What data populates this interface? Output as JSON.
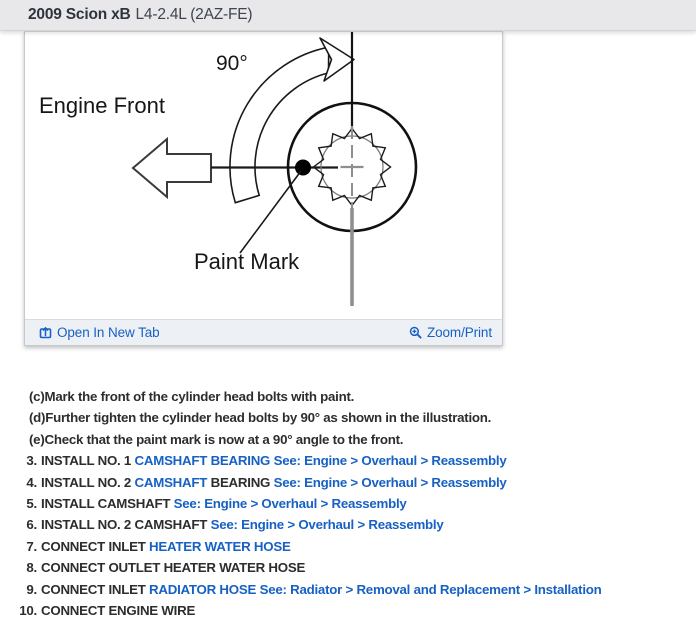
{
  "header": {
    "title_bold": "2009 Scion xB",
    "title_rest": "L4-2.4L (2AZ-FE)"
  },
  "figure": {
    "labels": {
      "angle": "90°",
      "engine_front": "Engine Front",
      "paint_mark": "Paint Mark"
    },
    "toolbar": {
      "open_in_new_tab": "Open In New Tab",
      "zoom_print": "Zoom/Print"
    },
    "icons": {
      "open_in_new_tab": "open-in-new-tab-icon",
      "zoom_print": "magnifier-plus-icon"
    },
    "colors": {
      "link_blue": "#1761c4",
      "diagram_ink": "#161616",
      "diagram_gray": "#8f8f8f"
    }
  },
  "steps": [
    {
      "num": "",
      "segments": [
        {
          "text": "(c)Mark the front of the cylinder head bolts with paint.",
          "style": "dark"
        }
      ]
    },
    {
      "num": "",
      "segments": [
        {
          "text": "(d)Further tighten the cylinder head bolts by 90° as shown in the illustration.",
          "style": "dark"
        }
      ]
    },
    {
      "num": "",
      "segments": [
        {
          "text": "(e)Check that the paint mark is now at a 90° angle to the front.",
          "style": "dark"
        }
      ]
    },
    {
      "num": "3.",
      "segments": [
        {
          "text": "INSTALL NO. 1 ",
          "style": "dark"
        },
        {
          "text": "CAMSHAFT BEARING ",
          "style": "link"
        },
        {
          "text": "See: Engine > Overhaul > Reassembly",
          "style": "link"
        }
      ]
    },
    {
      "num": "4.",
      "segments": [
        {
          "text": "INSTALL NO. 2 ",
          "style": "dark"
        },
        {
          "text": "CAMSHAFT",
          "style": "link"
        },
        {
          "text": " BEARING ",
          "style": "dark"
        },
        {
          "text": "See: Engine > Overhaul > Reassembly",
          "style": "link"
        }
      ]
    },
    {
      "num": "5.",
      "segments": [
        {
          "text": "INSTALL CAMSHAFT ",
          "style": "dark"
        },
        {
          "text": "See: Engine > Overhaul > Reassembly",
          "style": "link"
        }
      ]
    },
    {
      "num": "6.",
      "segments": [
        {
          "text": "INSTALL NO. 2 CAMSHAFT ",
          "style": "dark"
        },
        {
          "text": "See: Engine > Overhaul > Reassembly",
          "style": "link"
        }
      ]
    },
    {
      "num": "7.",
      "segments": [
        {
          "text": "CONNECT INLET ",
          "style": "dark"
        },
        {
          "text": "HEATER WATER HOSE",
          "style": "link"
        }
      ]
    },
    {
      "num": "8.",
      "segments": [
        {
          "text": "CONNECT OUTLET HEATER WATER HOSE",
          "style": "dark"
        }
      ]
    },
    {
      "num": "9.",
      "segments": [
        {
          "text": "CONNECT INLET ",
          "style": "dark"
        },
        {
          "text": "RADIATOR HOSE ",
          "style": "link"
        },
        {
          "text": "See: Radiator > Removal and Replacement > Installation",
          "style": "link"
        }
      ]
    },
    {
      "num": "10.",
      "segments": [
        {
          "text": "CONNECT ENGINE WIRE",
          "style": "dark"
        }
      ]
    }
  ]
}
